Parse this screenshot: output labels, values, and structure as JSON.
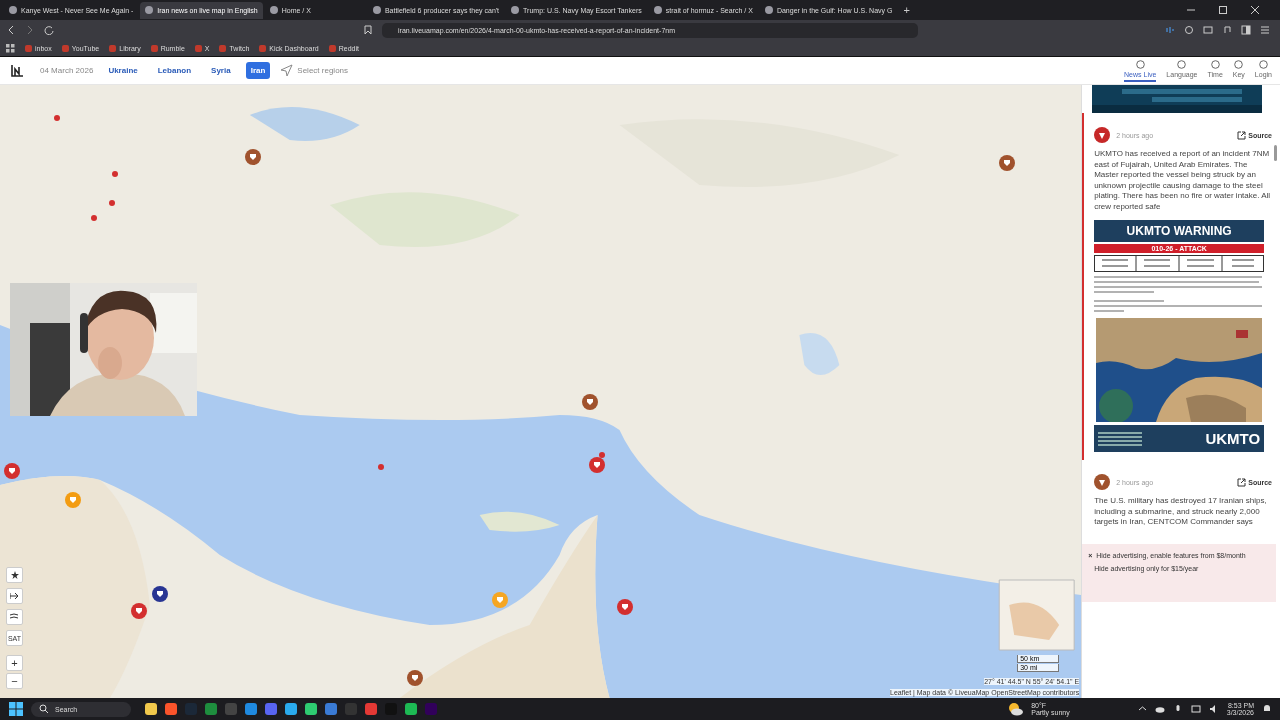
{
  "browser": {
    "tabs": [
      {
        "title": "Kanye West - Never See Me Again - ",
        "selected": false
      },
      {
        "title": "Iran news on live map in English",
        "selected": true
      },
      {
        "title": "Home / X",
        "selected": false
      },
      {
        "title": "Battlefield 6 producer says they can't",
        "selected": false
      },
      {
        "title": "Trump: U.S. Navy May Escort Tankers",
        "selected": false
      },
      {
        "title": "strait of hormuz - Search / X",
        "selected": false
      },
      {
        "title": "Danger in the Gulf: How U.S. Navy G",
        "selected": false
      }
    ],
    "new_tab": "+",
    "url": "iran.liveuamap.com/en/2026/4-march-00-ukmto-has-received-a-report-of-an-incident-7nm",
    "bookmarks": [
      "inbox",
      "YouTube",
      "Library",
      "Rumble",
      "X",
      "Twitch",
      "Kick Dashboard",
      "Reddit"
    ]
  },
  "site": {
    "date": "04 March 2026",
    "regions": [
      {
        "label": "Ukraine",
        "selected": false
      },
      {
        "label": "Lebanon",
        "selected": false
      },
      {
        "label": "Syria",
        "selected": false
      },
      {
        "label": "Iran",
        "selected": true
      }
    ],
    "select_regions": "Select regions",
    "menu": [
      {
        "label": "News Live",
        "selected": true
      },
      {
        "label": "Language",
        "selected": false
      },
      {
        "label": "Time",
        "selected": false
      },
      {
        "label": "Key",
        "selected": false
      },
      {
        "label": "Login",
        "selected": false
      }
    ]
  },
  "map": {
    "markers": [
      {
        "color": "#a0522d"
      },
      {
        "color": "#a0522d"
      },
      {
        "color": "#d32f2f"
      },
      {
        "color": "#d32f2f"
      },
      {
        "color": "#f5a623"
      },
      {
        "color": "#283593"
      },
      {
        "color": "#d32f2f"
      },
      {
        "color": "#f39c12"
      },
      {
        "color": "#d32f2f"
      },
      {
        "color": "#a0522d"
      },
      {
        "color": "#a0522d"
      }
    ],
    "sat": "SAT",
    "zoom": [
      "+",
      "−"
    ],
    "scale": [
      "50 km",
      "30 mi"
    ],
    "coordinates": "27° 41' 44.5\" N 55° 24' 54.1\" E",
    "attribution": "Leaflet | Map data © LiveuaMap OpenStreetMap contributors"
  },
  "news": [
    {
      "time": "2 hours ago",
      "source": "Source",
      "highlighted": true,
      "color": "#c62828",
      "text": "UKMTO has received a report of an incident 7NM east of Fujairah, United Arab Emirates. The Master reported the vessel being struck by an unknown projectile causing damage to the steel plating. There has been no fire or water intake. All crew reported safe",
      "warning": {
        "title": "UKMTO WARNING",
        "banner": "010-26 - ATTACK",
        "logo": "UKMTO"
      }
    },
    {
      "time": "2 hours ago",
      "source": "Source",
      "highlighted": false,
      "color": "#a0522d",
      "text": "The U.S. military has destroyed 17 Iranian ships, including a submarine, and struck nearly 2,000 targets in Iran, CENTCOM Commander says"
    }
  ],
  "ad": {
    "close": "×",
    "lines": [
      "Hide advertising, enable features from $8/month",
      "Hide advertising only for $15/year"
    ]
  },
  "taskbar": {
    "search": "Search",
    "temperature": "80°F",
    "weather": "Partly sunny",
    "time": "8:53 PM",
    "date": "3/3/2026"
  }
}
